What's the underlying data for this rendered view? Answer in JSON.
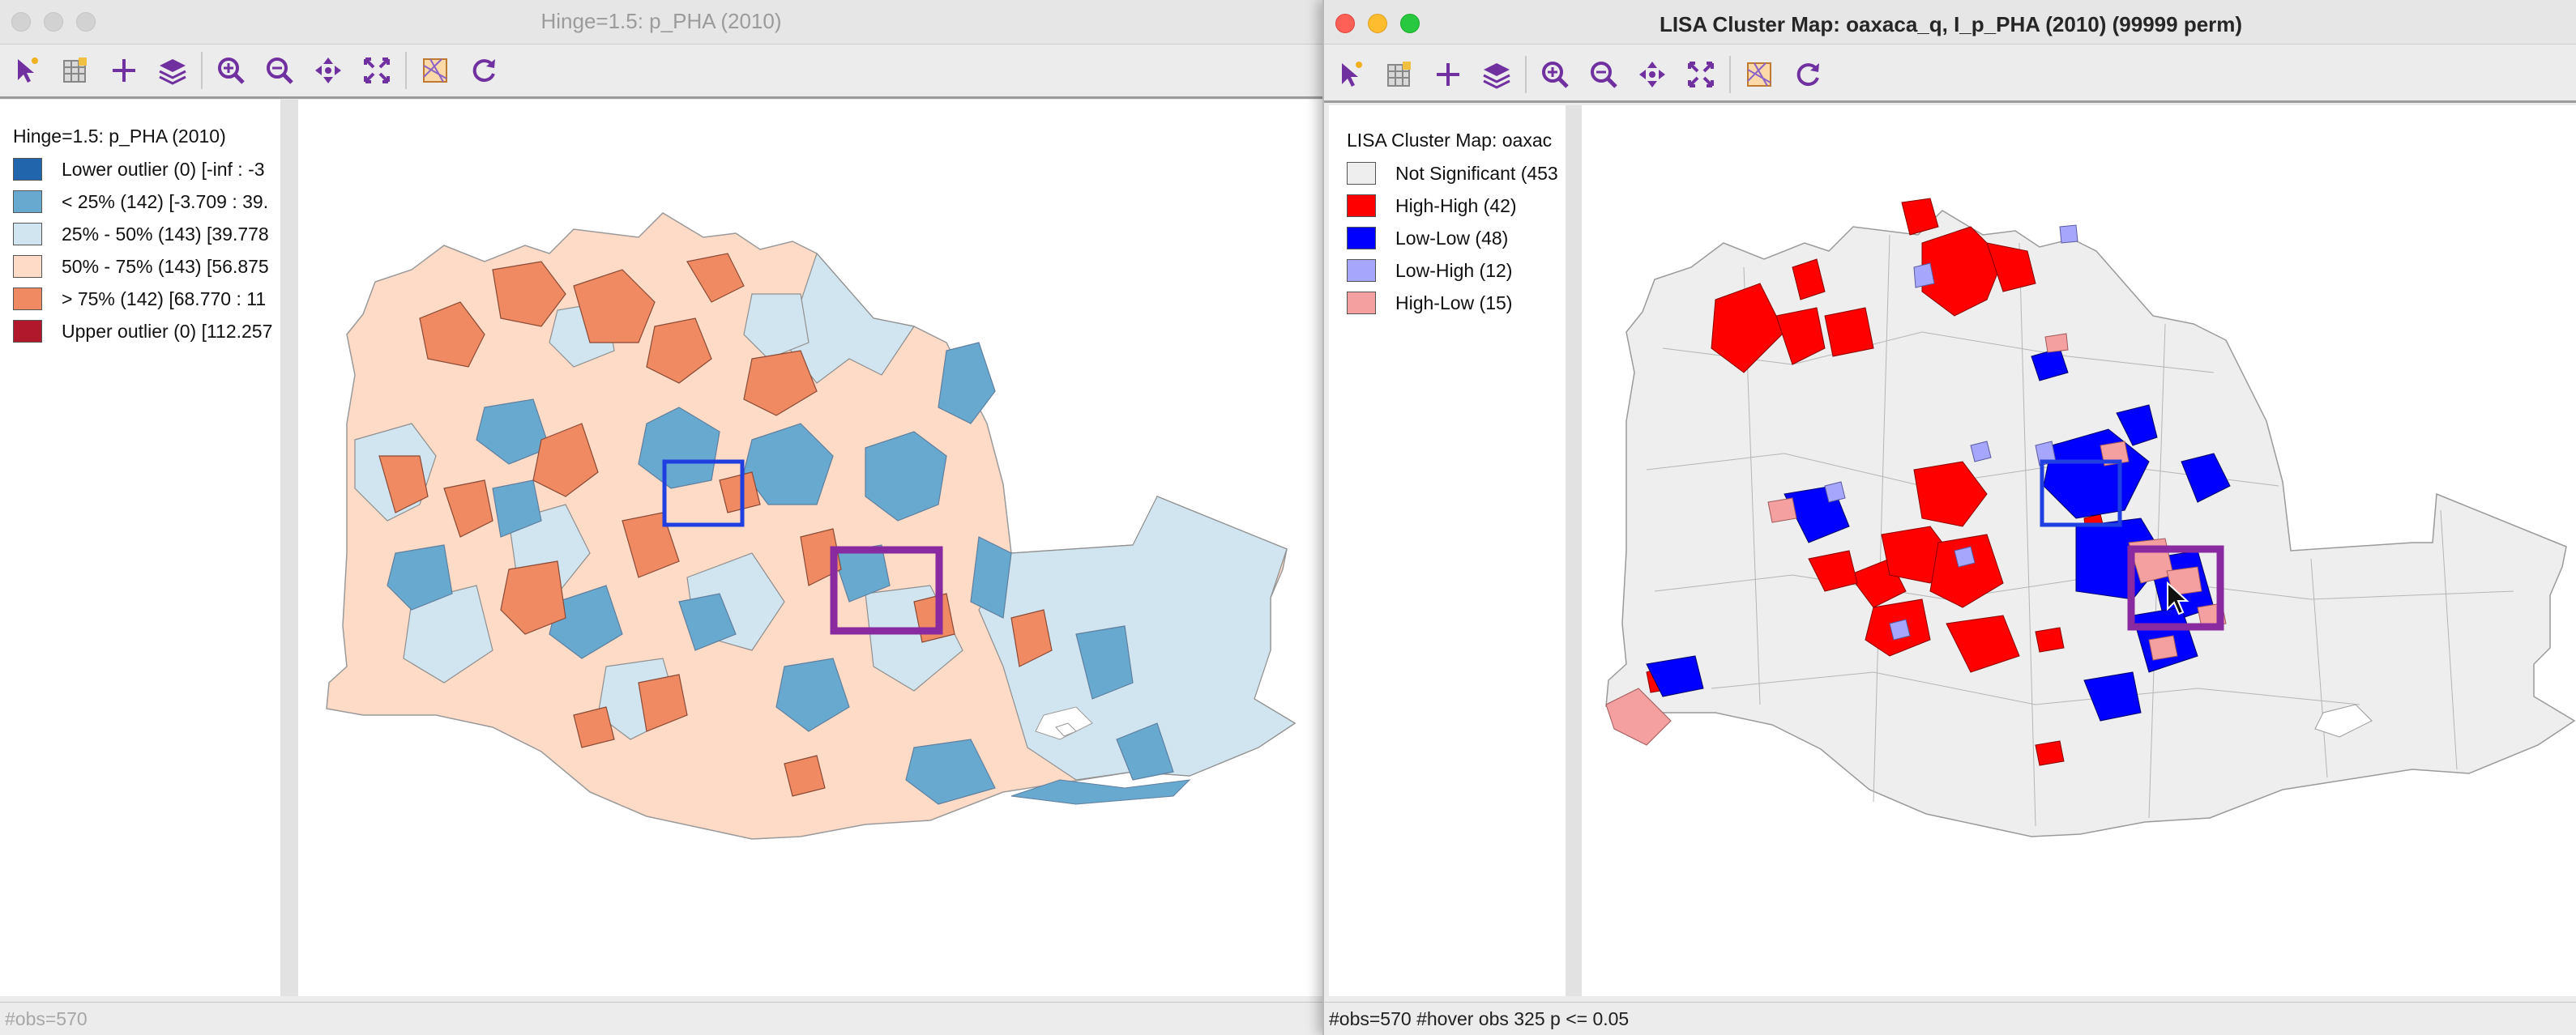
{
  "left_window": {
    "title": "Hinge=1.5: p_PHA (2010)",
    "legend": {
      "title": "Hinge=1.5: p_PHA (2010)",
      "items": [
        {
          "label": "Lower outlier (0)  [-inf : -3",
          "color": "#2166ac"
        },
        {
          "label": "< 25% (142)  [-3.709 : 39.",
          "color": "#67a9cf"
        },
        {
          "label": "25% - 50% (143)  [39.778",
          "color": "#d1e5f0"
        },
        {
          "label": "50% - 75% (143)  [56.875",
          "color": "#fddbc7"
        },
        {
          "label": "> 75% (142)  [68.770 : 11",
          "color": "#ef8a62"
        },
        {
          "label": "Upper outlier (0)  [112.257",
          "color": "#b2182b"
        }
      ]
    },
    "status": "#obs=570"
  },
  "right_window": {
    "title": "LISA Cluster Map: oaxaca_q, I_p_PHA (2010) (99999 perm)",
    "legend": {
      "title": "LISA Cluster Map: oaxac",
      "items": [
        {
          "label": "Not Significant (453",
          "color": "#eeeeee"
        },
        {
          "label": "High-High (42)",
          "color": "#ff0000"
        },
        {
          "label": "Low-Low (48)",
          "color": "#0000ff"
        },
        {
          "label": "Low-High (12)",
          "color": "#a7a6fd"
        },
        {
          "label": "High-Low (15)",
          "color": "#f4a0a1"
        }
      ]
    },
    "status": "#obs=570 #hover obs 325 p <= 0.05"
  },
  "toolbar_icons": [
    "select-icon",
    "table-icon",
    "crosshair-icon",
    "layers-icon",
    "zoom-in-icon",
    "zoom-out-icon",
    "pan-icon",
    "fit-extent-icon",
    "basemap-icon",
    "refresh-icon"
  ],
  "highlight_colors": {
    "selection_box": "#1f3fe0",
    "hover_box": "#8a2aa0"
  }
}
